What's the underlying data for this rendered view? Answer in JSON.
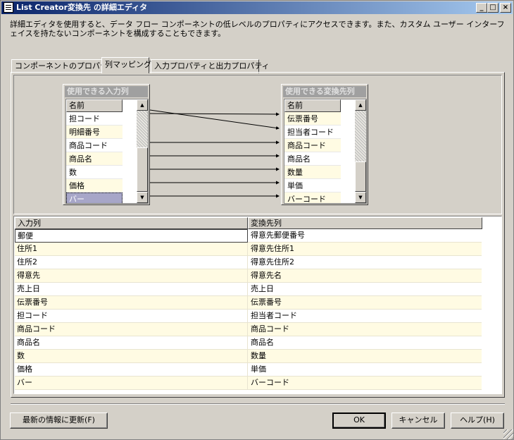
{
  "window": {
    "title": "List Creator変換先 の詳細エディタ",
    "minimize": "_",
    "maximize": "□",
    "close": "×"
  },
  "description": "詳細エディタを使用すると、データ フロー コンポーネントの低レベルのプロパティにアクセスできます。また、カスタム ユーザー インターフェイスを持たないコンポーネントを構成することもできます。",
  "tabs": {
    "component_properties": "コンポーネントのプロパティ",
    "column_mapping": "列マッピング",
    "io_properties": "入力プロパティと出力プロパティ"
  },
  "source_box": {
    "title": "使用できる入力列",
    "header": "名前",
    "items": [
      "担コード",
      "明細番号",
      "商品コード",
      "商品名",
      "数",
      "価格",
      "バー"
    ]
  },
  "dest_box": {
    "title": "使用できる変換先列",
    "header": "名前",
    "items": [
      "伝票番号",
      "担当者コード",
      "商品コード",
      "商品名",
      "数量",
      "単価",
      "バーコード"
    ]
  },
  "scroll": {
    "up": "▲",
    "down": "▼"
  },
  "grid": {
    "col_input": "入力列",
    "col_dest": "変換先列",
    "rows": [
      [
        "郵便",
        "得意先郵便番号"
      ],
      [
        "住所1",
        "得意先住所1"
      ],
      [
        "住所2",
        "得意先住所2"
      ],
      [
        "得意先",
        "得意先名"
      ],
      [
        "売上日",
        "売上日"
      ],
      [
        "伝票番号",
        "伝票番号"
      ],
      [
        "担コード",
        "担当者コード"
      ],
      [
        "商品コード",
        "商品コード"
      ],
      [
        "商品名",
        "商品名"
      ],
      [
        "数",
        "数量"
      ],
      [
        "価格",
        "単価"
      ],
      [
        "バー",
        "バーコード"
      ]
    ]
  },
  "buttons": {
    "refresh": "最新の情報に更新(F)",
    "ok": "OK",
    "cancel": "キャンセル",
    "help": "ヘルプ(H)"
  }
}
